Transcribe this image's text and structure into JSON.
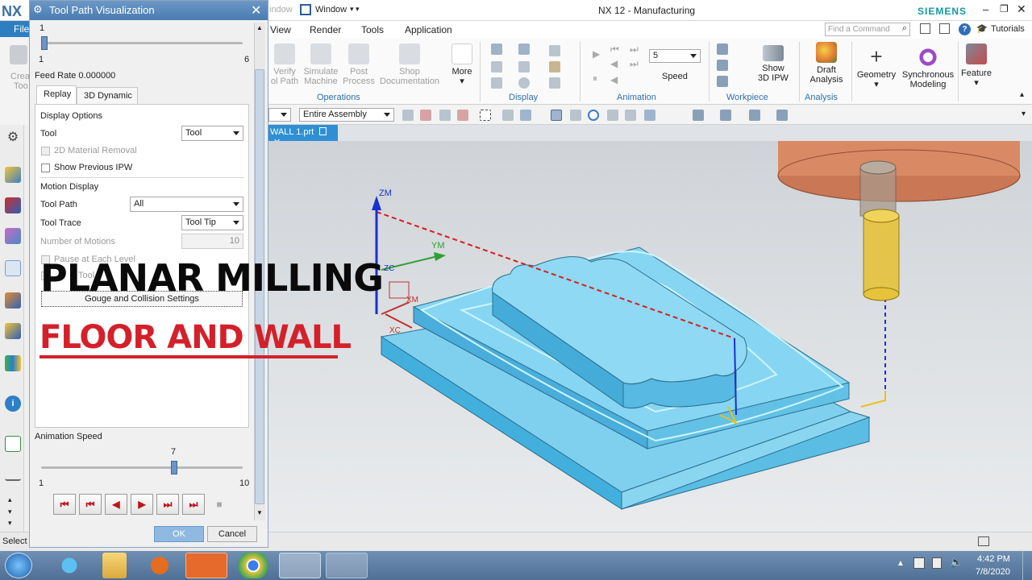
{
  "app": {
    "title": "NX 12 - Manufacturing",
    "brand": "SIEMENS",
    "logo": "NX",
    "window_menu": "Window",
    "window_partial": "indow",
    "command_placeholder": "Find a Command",
    "tutorials": "Tutorials",
    "file_label": "File"
  },
  "menu": [
    "View",
    "Render",
    "Tools",
    "Application"
  ],
  "ribbon": {
    "left_partial": [
      "Crea",
      "Too"
    ],
    "operations": [
      {
        "label": "Verify\nTool Path",
        "short": "Verify",
        "short2": "ol Path"
      },
      {
        "label": "Simulate\nMachine",
        "short": "Simulate",
        "short2": "Machine"
      },
      {
        "label": "Post\nProcess",
        "short": "Post",
        "short2": "Process"
      },
      {
        "label": "Shop\nDocumentation",
        "short": "Shop",
        "short2": "Documentation"
      }
    ],
    "more": "More",
    "groups": {
      "operations": "Operations",
      "display": "Display",
      "animation": "Animation",
      "workpiece": "Workpiece",
      "analysis": "Analysis"
    },
    "speed_value": "5",
    "speed_label": "Speed",
    "show_ipw": "Show\n3D IPW",
    "show_ipw_1": "Show",
    "show_ipw_2": "3D IPW",
    "draft_1": "Draft",
    "draft_2": "Analysis",
    "geometry": "Geometry",
    "sync_1": "Synchronous",
    "sync_2": "Modeling",
    "feature": "Feature"
  },
  "toolbar2": {
    "assembly_select": "Entire Assembly"
  },
  "viewport": {
    "tab": "WALL 1.prt",
    "axes": {
      "zm": "ZM",
      "ym": "YM",
      "xm": "XM",
      "zc": "ZC",
      "xc": "XC"
    }
  },
  "dialog": {
    "title": "Tool Path Visualization",
    "top_slider": {
      "value": "1",
      "min": "1",
      "max": "6",
      "fraction": 0.0
    },
    "feed_rate": "Feed Rate 0.000000",
    "tabs": [
      "Replay",
      "3D Dynamic"
    ],
    "display_options": "Display Options",
    "tool_label": "Tool",
    "tool_value": "Tool",
    "material_removal": "2D Material Removal",
    "show_previous_ipw": "Show Previous IPW",
    "motion_display": "Motion Display",
    "tool_path_label": "Tool Path",
    "tool_path_value": "All",
    "tool_trace_label": "Tool Trace",
    "tool_trace_value": "Tool Tip",
    "number_of_motions_label": "Number of Motions",
    "number_of_motions_value": "10",
    "pause_each_level": "Pause at Each Level",
    "tool_partial": "Tool",
    "gouge_button": "Gouge and Collision Settings",
    "animation_speed": "Animation Speed",
    "speed_slider": {
      "value": "7",
      "min": "1",
      "max": "10",
      "fraction": 0.6667
    },
    "ok": "OK",
    "cancel": "Cancel"
  },
  "overlay": {
    "title": "PLANAR MILLING",
    "subtitle": "FLOOR AND WALL"
  },
  "status": {
    "select": "Select"
  },
  "taskbar": {
    "time": "4:42 PM",
    "date": "7/8/2020"
  },
  "colors": {
    "part": "#7fd0ef",
    "part_dark": "#3da9d8",
    "tool_holder": "#d98a64",
    "tool_shank": "#e6c33a",
    "toolpath_red": "#d42020",
    "toolpath_blue": "#1b2fd0",
    "dialog_title": "#5586bb",
    "overlay_red": "#d4202a"
  },
  "icons": [
    "file-icon",
    "close-icon",
    "gear-icon",
    "search-icon",
    "help-icon",
    "start-icon",
    "ie-icon",
    "folder-icon",
    "media-icon",
    "chrome-icon",
    "nx-icon"
  ]
}
